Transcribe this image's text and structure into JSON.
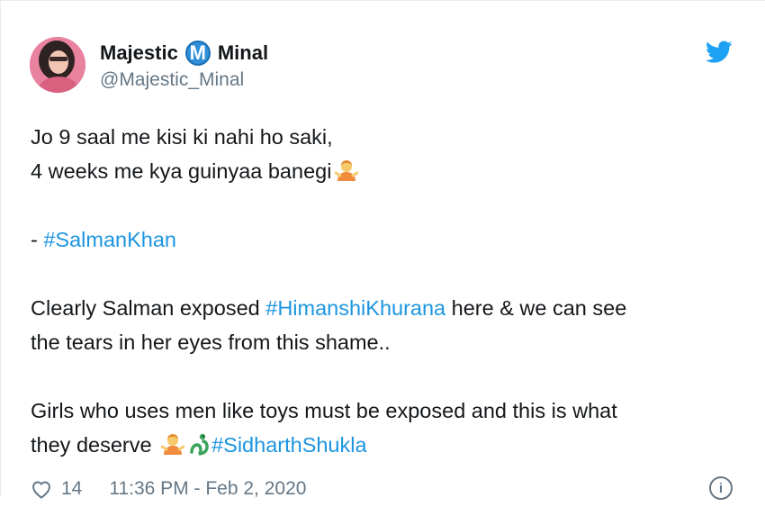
{
  "tweet": {
    "author": {
      "name_first": "Majestic",
      "badge_letter": "M",
      "name_last": "Minal",
      "handle": "@Majestic_Minal"
    },
    "lines": {
      "l1": "Jo 9 saal me kisi ki nahi ho saki,",
      "l2": "4 weeks me kya guinyaa banegi",
      "l3_prefix": "- ",
      "l3_tag": "#SalmanKhan",
      "l4_a": "Clearly Salman exposed ",
      "l4_tag": "#HimanshiKhurana",
      "l4_b": " here & we can see",
      "l5": "the tears in her eyes from this shame..",
      "l6": "Girls who uses men like toys must be exposed and this is what",
      "l7_a": "they deserve ",
      "l7_tag": "#SidharthShukla"
    },
    "footer": {
      "likes": "14",
      "timestamp": "11:36 PM - Feb 2, 2020"
    },
    "icons": {
      "brand": "twitter-bird-icon",
      "like": "heart-icon",
      "info": "info-icon"
    },
    "colors": {
      "hashtag": "#1b95e0",
      "brand": "#1da1f2",
      "muted": "#657786"
    }
  }
}
